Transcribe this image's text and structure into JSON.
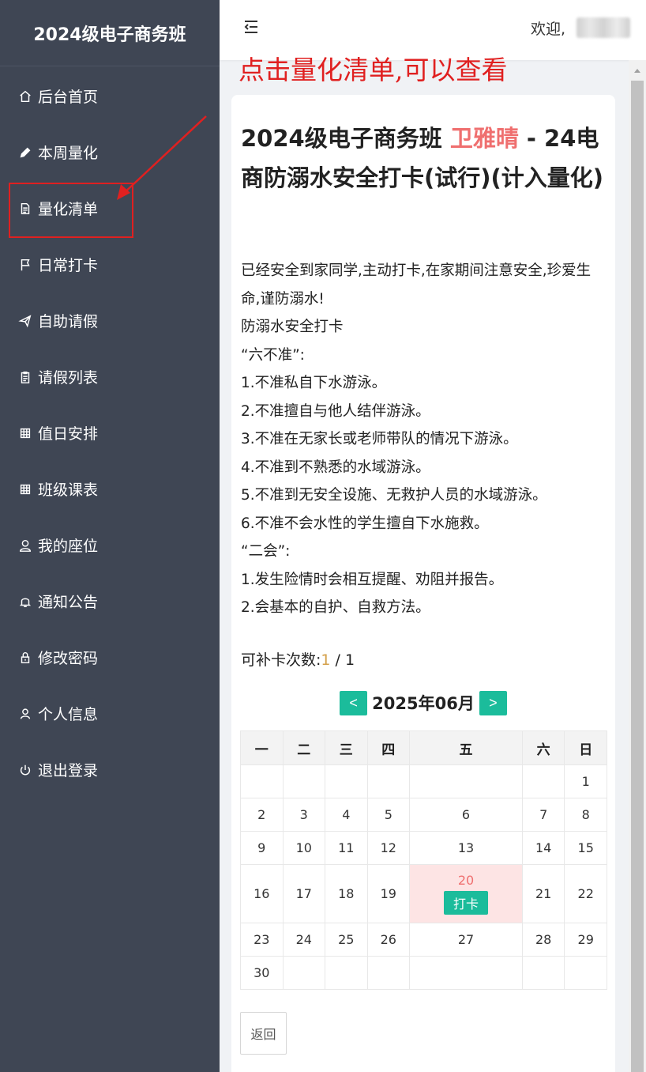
{
  "sidebar": {
    "brand": "2024级电子商务班",
    "items": [
      {
        "label": "后台首页",
        "icon": "home-icon"
      },
      {
        "label": "本周量化",
        "icon": "pencil-icon"
      },
      {
        "label": "量化清单",
        "icon": "document-icon"
      },
      {
        "label": "日常打卡",
        "icon": "flag-icon"
      },
      {
        "label": "自助请假",
        "icon": "paper-plane-icon"
      },
      {
        "label": "请假列表",
        "icon": "clipboard-icon"
      },
      {
        "label": "值日安排",
        "icon": "grid-icon"
      },
      {
        "label": "班级课表",
        "icon": "grid-icon"
      },
      {
        "label": "我的座位",
        "icon": "user-icon"
      },
      {
        "label": "通知公告",
        "icon": "bell-icon"
      },
      {
        "label": "修改密码",
        "icon": "lock-icon"
      },
      {
        "label": "个人信息",
        "icon": "person-icon"
      },
      {
        "label": "退出登录",
        "icon": "power-icon"
      }
    ]
  },
  "header": {
    "welcome": "欢迎,"
  },
  "annotation": {
    "text": "点击量化清单,可以查看",
    "color": "#e02020"
  },
  "card": {
    "title_prefix": "2024级电子商务班 ",
    "title_name": "卫雅晴",
    "title_suffix": " - 24电商防溺水安全打卡(试行)(计入量化)",
    "content_lines": [
      "已经安全到家同学,主动打卡,在家期间注意安全,珍爱生命,谨防溺水!",
      "防溺水安全打卡",
      "“六不准”:",
      "1.不准私自下水游泳。",
      "2.不准擅自与他人结伴游泳。",
      "3.不准在无家长或老师带队的情况下游泳。",
      "4.不准到不熟悉的水域游泳。",
      "5.不准到无安全设施、无救护人员的水域游泳。",
      "6.不准不会水性的学生擅自下水施救。",
      "“二会”:",
      "1.发生险情时会相互提醒、劝阻并报告。",
      "2.会基本的自护、自救方法。"
    ],
    "makeup_label": "可补卡次数:",
    "makeup_used": "1",
    "makeup_total": " / 1",
    "calendar": {
      "prev": "<",
      "next": ">",
      "month_label": "2025年06月",
      "weekdays": [
        "一",
        "二",
        "三",
        "四",
        "五",
        "六",
        "日"
      ],
      "weeks": [
        [
          "",
          "",
          "",
          "",
          "",
          "",
          "1"
        ],
        [
          "2",
          "3",
          "4",
          "5",
          "6",
          "7",
          "8"
        ],
        [
          "9",
          "10",
          "11",
          "12",
          "13",
          "14",
          "15"
        ],
        [
          "16",
          "17",
          "18",
          "19",
          "20",
          "21",
          "22"
        ],
        [
          "23",
          "24",
          "25",
          "26",
          "27",
          "28",
          "29"
        ],
        [
          "30",
          "",
          "",
          "",
          "",
          "",
          ""
        ]
      ],
      "today": "20",
      "punch_label": "打卡"
    },
    "back_label": "返回"
  },
  "colors": {
    "sidebar_bg": "#3f4654",
    "accent": "#1bbc9b",
    "name_red": "#ef6f6f",
    "today_bg": "#fde4e4"
  }
}
